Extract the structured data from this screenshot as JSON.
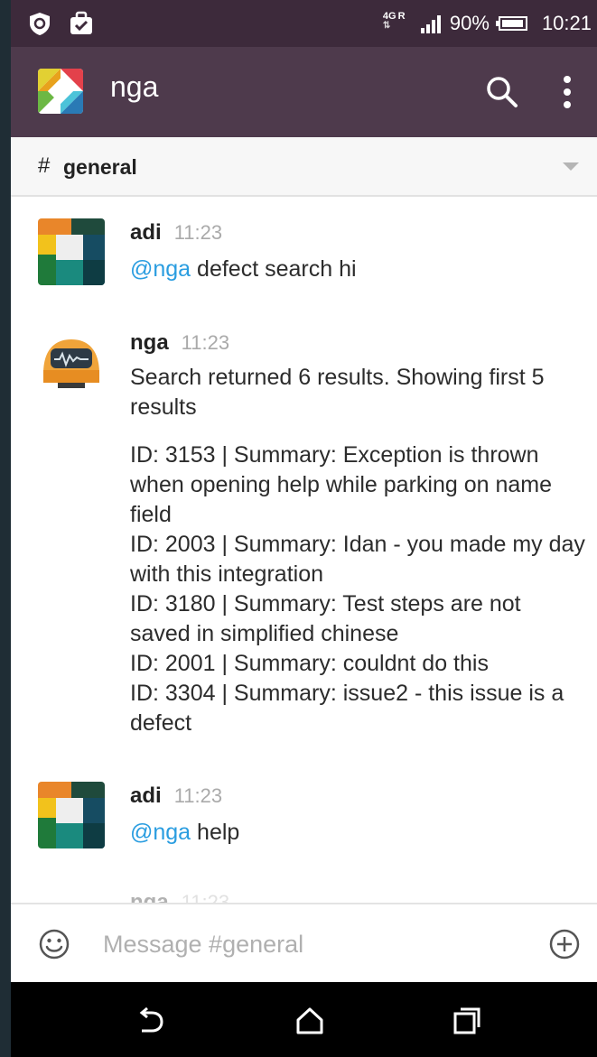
{
  "status_bar": {
    "network": "4G",
    "roaming": "R",
    "battery": "90%",
    "time": "10:21"
  },
  "app_bar": {
    "team_name": "nga",
    "icons": [
      "search-icon",
      "overflow-menu-icon"
    ]
  },
  "channel": {
    "hash": "#",
    "name": "general"
  },
  "messages": [
    {
      "author": "adi",
      "time": "11:23",
      "mention": "@nga",
      "text": " defect search hi"
    },
    {
      "author": "nga",
      "time": "11:23",
      "intro": "Search returned 6 results. Showing first 5 results",
      "results": [
        "ID: 3153 | Summary: Exception is thrown when opening help while parking on name field",
        "ID: 2003 | Summary: Idan - you made my day with this integration",
        "ID: 3180 | Summary: Test steps are not saved in simplified chinese",
        "ID: 2001 | Summary: couldnt do this",
        "ID: 3304 | Summary: issue2 - this issue is a defect"
      ]
    },
    {
      "author": "adi",
      "time": "11:23",
      "mention": "@nga",
      "text": " help"
    },
    {
      "author": "nga",
      "time": "11:23"
    }
  ],
  "composer": {
    "placeholder": "Message #general"
  },
  "nav": {
    "icons": [
      "back-icon",
      "home-icon",
      "recents-icon"
    ]
  },
  "colors": {
    "status_bar": "#3d2a3b",
    "app_bar": "#4e3a4c",
    "mention": "#2a9de0"
  }
}
